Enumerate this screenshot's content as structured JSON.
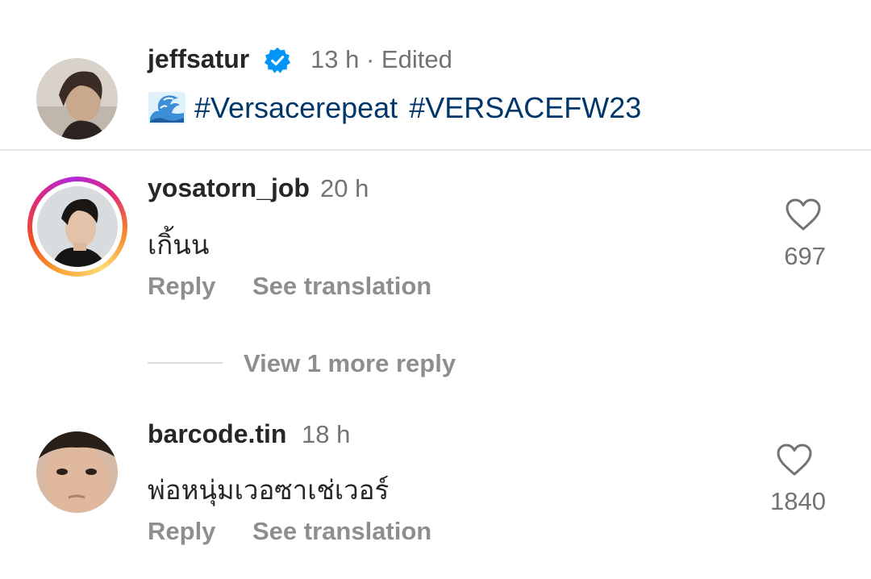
{
  "caption": {
    "username": "jeffsatur",
    "verified": true,
    "time": "13 h",
    "edited": "· Edited",
    "emoji": "water-wave-emoji",
    "hashtags": [
      "#Versacerepeat",
      "#VERSACEFW23"
    ]
  },
  "comments": [
    {
      "username": "yosatorn_job",
      "time": "20 h",
      "text": "เกิ้นน",
      "likes": "697",
      "has_story": true,
      "reply_label": "Reply",
      "translate_label": "See translation",
      "view_more": "View 1 more reply"
    },
    {
      "username": "barcode.tin",
      "time": "18 h",
      "text": "พ่อหนุ่มเวอซาเช่เวอร์",
      "likes": "1840",
      "has_story": false,
      "reply_label": "Reply",
      "translate_label": "See translation"
    }
  ],
  "colors": {
    "hashtag": "#00376b",
    "verified_badge": "#0095f6",
    "muted_text": "#737373",
    "action_text": "#8e8e8e"
  },
  "icons": [
    "verified-badge-icon",
    "heart-icon"
  ]
}
